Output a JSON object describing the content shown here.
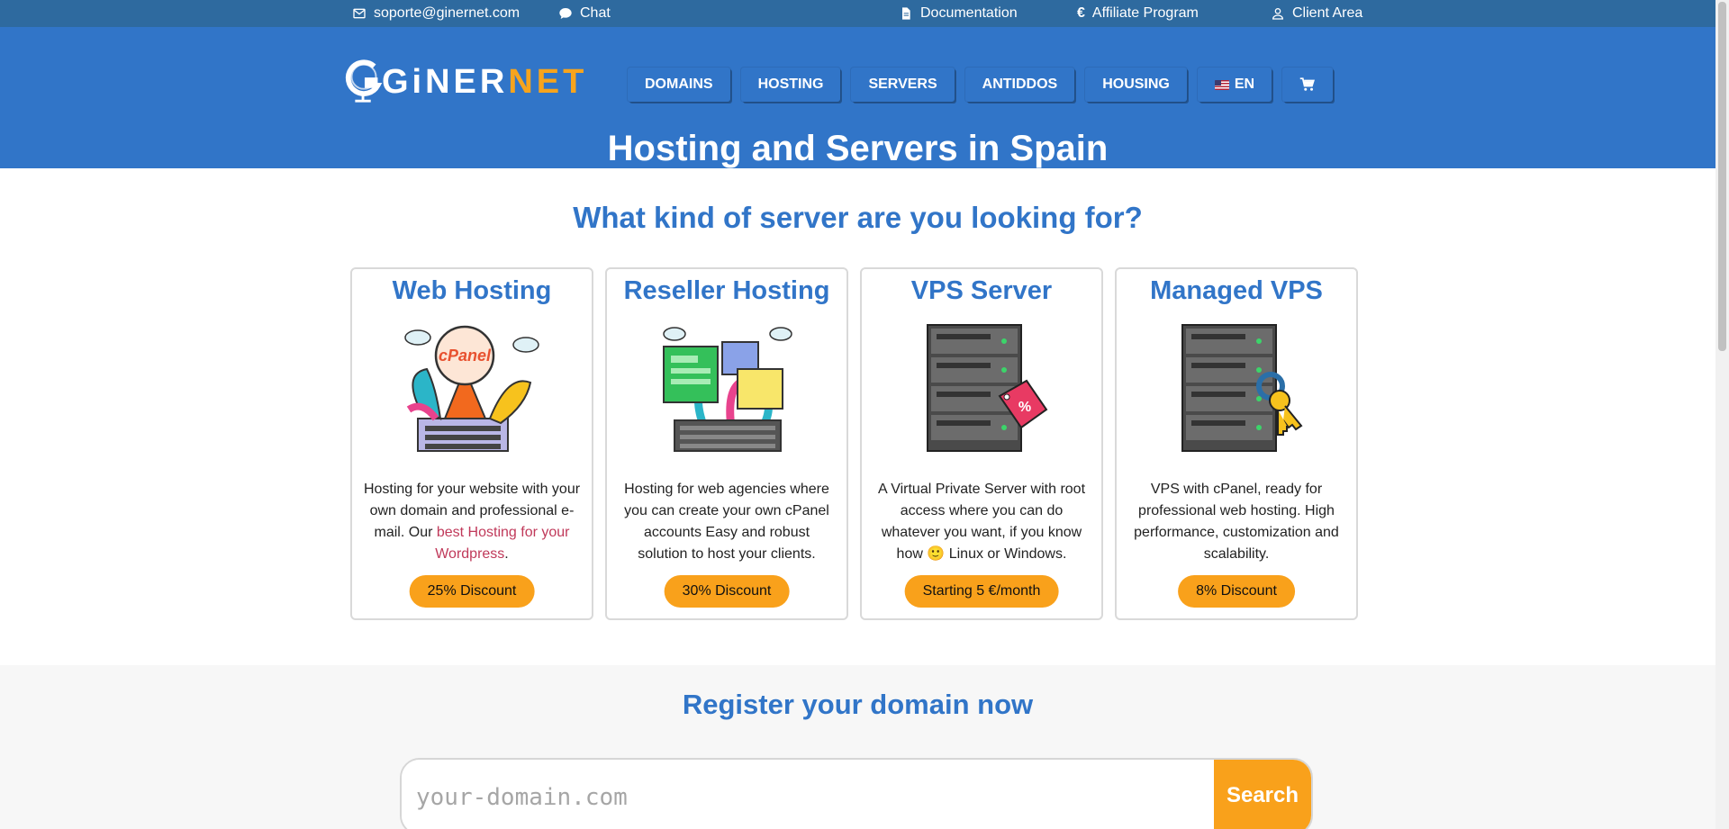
{
  "topbar": {
    "email": "soporte@ginernet.com",
    "chat": "Chat",
    "documentation": "Documentation",
    "affiliate": "Affiliate Program",
    "client_area": "Client Area"
  },
  "logo": {
    "gi": "GiNER",
    "net": "NET"
  },
  "nav": {
    "items": [
      "DOMAINS",
      "HOSTING",
      "SERVERS",
      "ANTIDDOS",
      "HOUSING"
    ],
    "lang": "EN"
  },
  "hero": {
    "title": "Hosting and Servers in Spain"
  },
  "servers": {
    "heading": "What kind of server are you looking for?",
    "cards": [
      {
        "title": "Web Hosting",
        "desc_before": "Hosting for your website with your own domain and professional e-mail. Our ",
        "desc_link": "best Hosting for your Wordpress",
        "desc_after": ".",
        "badge": "25% Discount",
        "logo_text": "cPanel"
      },
      {
        "title": "Reseller Hosting",
        "desc": "Hosting for web agencies where you can create your own cPanel accounts Easy and robust solution to host your clients.",
        "badge": "30% Discount"
      },
      {
        "title": "VPS Server",
        "desc_before": "A Virtual Private Server with root access where you can do whatever you want, if you know how ",
        "emoji": "🙂",
        "desc_after": " Linux or Windows.",
        "badge": "Starting 5 €/month",
        "tag_text": "%"
      },
      {
        "title": "Managed VPS",
        "desc": "VPS with cPanel, ready for professional web hosting. High performance, customization and scalability.",
        "badge": "8% Discount"
      }
    ]
  },
  "domain": {
    "heading": "Register your domain now",
    "placeholder": "your-domain.com",
    "button": "Search"
  },
  "colors": {
    "primary": "#3175c8",
    "topbar": "#2e6a9f",
    "accent": "#f9a11b",
    "link": "#c0395a"
  }
}
